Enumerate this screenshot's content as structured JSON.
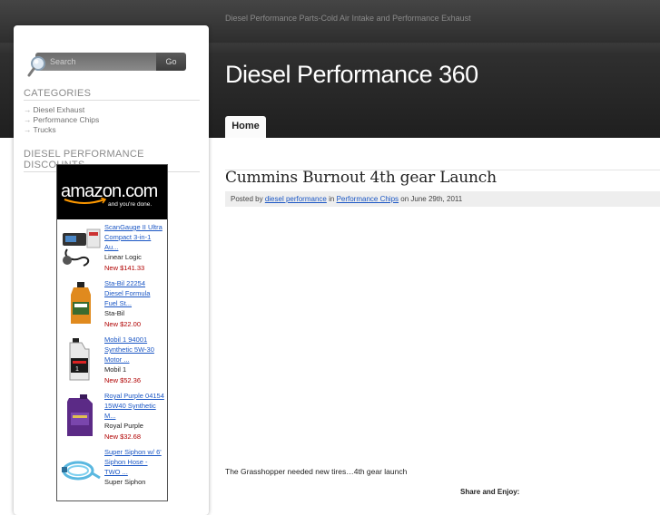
{
  "site": {
    "tagline": "Diesel Performance Parts-Cold Air Intake and Performance Exhaust",
    "title": "Diesel Performance 360"
  },
  "nav": {
    "items": [
      {
        "label": "Home"
      }
    ]
  },
  "search": {
    "placeholder": "Search",
    "button_label": "Go"
  },
  "sidebar": {
    "categories_title": "CATEGORIES",
    "categories": [
      {
        "label": "Diesel Exhaust"
      },
      {
        "label": "Performance Chips"
      },
      {
        "label": "Trucks"
      }
    ],
    "discounts_title": "DIESEL PERFORMANCE DISCOUNTS"
  },
  "amazon": {
    "logo": "amazon.com",
    "tagline": "and you're done.",
    "products": [
      {
        "title": "ScanGauge II Ultra Compact 3-in-1 Au...",
        "brand": "Linear Logic",
        "price": "New $141.33",
        "icon": "scangauge-icon"
      },
      {
        "title": "Sta-Bil 22254 Diesel Formula Fuel St...",
        "brand": "Sta-Bil",
        "price": "New $22.00",
        "icon": "stabil-bottle-icon"
      },
      {
        "title": "Mobil 1 94001 Synthetic 5W-30 Motor ...",
        "brand": "Mobil 1",
        "price": "New $52.36",
        "icon": "mobil-bottle-icon"
      },
      {
        "title": "Royal Purple 04154 15W40 Synthetic M...",
        "brand": "Royal Purple",
        "price": "New $32.68",
        "icon": "royal-purple-jug-icon"
      },
      {
        "title": "Super Siphon w/ 6' Siphon Hose - TWO ...",
        "brand": "Super Siphon",
        "price": "",
        "icon": "siphon-hose-icon"
      }
    ]
  },
  "post": {
    "title": "Cummins Burnout 4th gear Launch",
    "meta_posted_by": "Posted by",
    "meta_author": "diesel performance",
    "meta_in": "in",
    "meta_category": "Performance Chips",
    "meta_date": "on June 29th, 2011",
    "body": "The Grasshopper needed new tires…4th gear launch",
    "share_label": "Share and Enjoy:"
  }
}
